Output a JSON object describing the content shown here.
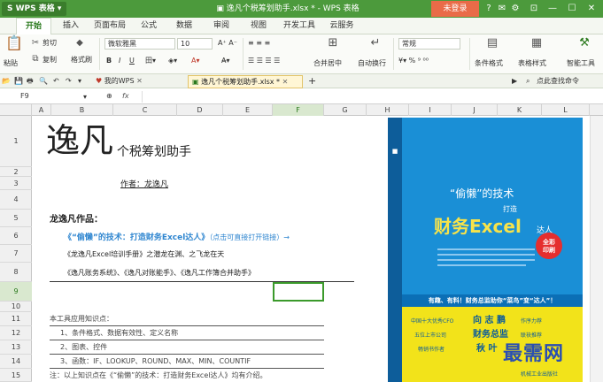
{
  "titlebar": {
    "app_name": "WPS 表格",
    "doc_title": "逸凡个税筹划助手.xlsx * - WPS 表格",
    "login": "未登录"
  },
  "menu": [
    "开始",
    "插入",
    "页面布局",
    "公式",
    "数据",
    "审阅",
    "视图",
    "开发工具",
    "云服务"
  ],
  "ribbon": {
    "cut": "剪切",
    "paste": "粘贴",
    "copy": "复制",
    "format_painter": "格式刷",
    "font_name": "微软雅黑",
    "font_size": "10",
    "merge_center": "合并居中",
    "wrap": "自动换行",
    "number_format": "常规",
    "cond_format": "条件格式",
    "table_style": "表格样式",
    "smart_tool": "智能工具"
  },
  "quickbar": {
    "tab_mywps": "我的WPS",
    "tab_doc": "逸凡个税筹划助手.xlsx *",
    "search": "点此查找命令"
  },
  "formula": {
    "cell_ref": "F9",
    "fx": "fx"
  },
  "columns": [
    "A",
    "B",
    "C",
    "D",
    "E",
    "F",
    "G",
    "H",
    "I",
    "J",
    "K",
    "L"
  ],
  "rows": [
    "1",
    "2",
    "3",
    "4",
    "5",
    "6",
    "7",
    "8",
    "9",
    "10",
    "11",
    "12",
    "13",
    "14",
    "15"
  ],
  "sheet": {
    "big_title": "逸凡",
    "subtitle": "个税筹划助手",
    "author": "作者：龙逸凡",
    "works_heading": "龙逸凡作品：",
    "work1": "《“偷懒”的技术：打造财务Excel达人》",
    "work1_link": "（点击可直接打开链接）→",
    "work2": "《龙逸凡Excel培训手册》之潜龙在渊、之飞龙在天",
    "work3": "《逸凡账务系统》、《逸凡对账能手》、《逸凡工作簿合并助手》",
    "knowledge_heading": "本工具应用知识点：",
    "k1": "1、条件格式、数据有效性、定义名称",
    "k2": "2、图表、控件",
    "k3": "3、函数：IF、LOOKUP、ROUND、MAX、MIN、COUNTIF",
    "note": "注：以上知识点在《“偷懒”的技术：打造财务Excel达人》均有介绍。"
  },
  "book": {
    "title_small": "“偷懒”的技术",
    "title_sub": "打造",
    "title_main": "财务Excel",
    "title_end": "达人",
    "badge_line1": "全彩",
    "badge_line2": "印刷",
    "slogan": "有趣、有料！财务总监助你“菜鸟”变“达人”！",
    "r1": "中国十大优秀CFO",
    "r1b": "向 志 鹏",
    "r1c": "作序力荐",
    "r2": "五位上市公司",
    "r2b": "财务总监",
    "r2c": "联袂推荐",
    "r3": "畅销书作者",
    "r3b": "秋 叶",
    "r3c": "",
    "publisher": "机械工业出版社"
  },
  "watermark": "最需网",
  "colors": {
    "wps_green": "#4c9a3c",
    "login_red": "#e96b48",
    "book_blue": "#1a8fd6",
    "book_yellow": "#f2e31a",
    "link_blue": "#2f86d0",
    "watermark_blue": "#2a4fb2"
  }
}
